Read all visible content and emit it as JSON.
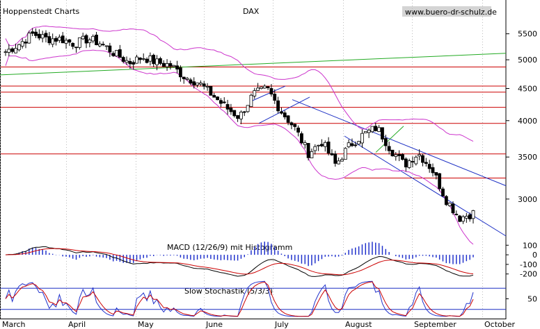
{
  "header": {
    "source": "Hoppenstedt Charts",
    "title": "DAX",
    "website": "www.buero-dr-schulz.de"
  },
  "colors": {
    "candle_up": "#ffffff",
    "candle_down": "#000000",
    "bollinger": "#cc33cc",
    "support_resistance": "#cc0000",
    "trend_channel": "#1c2fc4",
    "long_trend": "#22aa22",
    "macd_line": "#000000",
    "macd_signal": "#cc0000",
    "macd_histogram": "#2233cc",
    "stoch_k": "#2233cc",
    "stoch_d": "#cc0000"
  },
  "chart_data": [
    {
      "type": "candlestick",
      "title": "DAX",
      "y_scale": "log",
      "ylim": [
        2600,
        6100
      ],
      "yticks": [
        "5500",
        "5000",
        "4500",
        "4000",
        "3500",
        "3000"
      ],
      "x_months": [
        "March",
        "April",
        "May",
        "June",
        "July",
        "August",
        "September",
        "October"
      ],
      "horizontal_levels": [
        4870,
        4540,
        4440,
        4200,
        3960,
        3540,
        3240
      ],
      "approx_close_path": [
        {
          "month": "March",
          "values": [
            5150,
            5300,
            5500,
            5400
          ]
        },
        {
          "month": "April",
          "values": [
            5400,
            5300,
            5400,
            5300
          ]
        },
        {
          "month": "May",
          "values": [
            5100,
            4950,
            5050,
            4950,
            4900
          ]
        },
        {
          "month": "June",
          "values": [
            4700,
            4600,
            4400,
            4200,
            4050
          ]
        },
        {
          "month": "July",
          "values": [
            4400,
            4500,
            4150,
            3900,
            3550
          ]
        },
        {
          "month": "August",
          "values": [
            3700,
            3400,
            3650,
            3800,
            3900
          ]
        },
        {
          "month": "September",
          "values": [
            3600,
            3400,
            3550,
            3350,
            3000,
            2800
          ]
        }
      ],
      "last_close_approx": 2850
    },
    {
      "type": "line",
      "title": "MACD (12/26/9) mit Histogramm",
      "series_names": [],
      "yticks": [
        "100",
        "0",
        "-100",
        "-200"
      ],
      "ylim": [
        -260,
        160
      ]
    },
    {
      "type": "line",
      "title": "Slow Stochastik (5/3/3)",
      "series_names": [],
      "yticks": [
        "50"
      ],
      "ylim": [
        0,
        100
      ],
      "reference_levels": [
        80,
        20
      ]
    }
  ]
}
